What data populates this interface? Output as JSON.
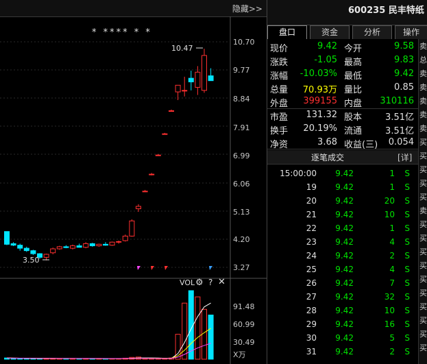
{
  "chart_header": {
    "hide_label": "隐藏>>"
  },
  "stock": {
    "code": "600235",
    "name": "民丰特纸"
  },
  "tabs": [
    "盘口",
    "资金",
    "分析",
    "操作"
  ],
  "quote_rows": [
    {
      "l1": "现价",
      "v1": "9.42",
      "c1": "green",
      "l2": "今开",
      "v2": "9.58",
      "c2": "green"
    },
    {
      "l1": "涨跌",
      "v1": "-1.05",
      "c1": "green",
      "l2": "最高",
      "v2": "9.83",
      "c2": "green"
    },
    {
      "l1": "涨幅",
      "v1": "-10.03%",
      "c1": "green",
      "l2": "最低",
      "v2": "9.42",
      "c2": "green"
    },
    {
      "l1": "总量",
      "v1": "70.93万",
      "c1": "yellow",
      "l2": "量比",
      "v2": "0.85",
      "c2": "white"
    },
    {
      "l1": "外盘",
      "v1": "399155",
      "c1": "red",
      "l2": "内盘",
      "v2": "310116",
      "c2": "green"
    },
    {
      "l1": "市盈",
      "v1": "131.32",
      "c1": "white",
      "l2": "股本",
      "v2": "3.51亿",
      "c2": "white"
    },
    {
      "l1": "换手",
      "v1": "20.19%",
      "c1": "white",
      "l2": "流通",
      "v2": "3.51亿",
      "c2": "white"
    },
    {
      "l1": "净资",
      "v1": "3.68",
      "c1": "white",
      "l2": "收益(三)",
      "v2": "0.054",
      "c2": "white"
    }
  ],
  "ticks_header": {
    "title": "逐笔成交",
    "detail": "[详]"
  },
  "ticks": [
    {
      "time": "15:00:00",
      "price": "9.42",
      "vol": "1",
      "side": "S"
    },
    {
      "time": "19",
      "price": "9.42",
      "vol": "1",
      "side": "S"
    },
    {
      "time": "20",
      "price": "9.42",
      "vol": "20",
      "side": "S"
    },
    {
      "time": "21",
      "price": "9.42",
      "vol": "10",
      "side": "S"
    },
    {
      "time": "22",
      "price": "9.42",
      "vol": "1",
      "side": "S"
    },
    {
      "time": "23",
      "price": "9.42",
      "vol": "4",
      "side": "S"
    },
    {
      "time": "24",
      "price": "9.42",
      "vol": "2",
      "side": "S"
    },
    {
      "time": "25",
      "price": "9.42",
      "vol": "4",
      "side": "S"
    },
    {
      "time": "26",
      "price": "9.42",
      "vol": "7",
      "side": "S"
    },
    {
      "time": "27",
      "price": "9.42",
      "vol": "32",
      "side": "S"
    },
    {
      "time": "28",
      "price": "9.42",
      "vol": "10",
      "side": "S"
    },
    {
      "time": "29",
      "price": "9.42",
      "vol": "16",
      "side": "S"
    },
    {
      "time": "30",
      "price": "9.42",
      "vol": "5",
      "side": "S"
    },
    {
      "time": "31",
      "price": "9.42",
      "vol": "2",
      "side": "S"
    }
  ],
  "side_labels": [
    "卖",
    "总",
    "卖",
    "卖",
    "卖",
    "卖",
    "卖",
    "买",
    "买",
    "买",
    "买",
    "买",
    "卖",
    "买",
    "买",
    "买",
    "买",
    "买",
    "买",
    "买",
    "买",
    "买",
    "买"
  ],
  "price_axis": [
    "10.70",
    "9.77",
    "8.84",
    "7.91",
    "6.99",
    "6.06",
    "5.13",
    "4.20",
    "3.27"
  ],
  "annotations": {
    "high": "10.47",
    "low": "3.50",
    "stars": "* **** * *"
  },
  "vol_panel": {
    "title": "VOL",
    "axis": [
      "91.48",
      "60.99",
      "30.49"
    ],
    "unit": "X万"
  },
  "colors": {
    "up": "#ff3030",
    "down": "#00e4ff",
    "ma1": "#ffffff",
    "ma2": "#ffff00",
    "ma3": "#ff44ff"
  },
  "chart_data": {
    "type": "candlestick",
    "ylim": [
      3.27,
      10.7
    ],
    "candles": [
      {
        "o": 4.45,
        "h": 4.45,
        "l": 4.0,
        "c": 4.03
      },
      {
        "o": 4.05,
        "h": 4.1,
        "l": 3.97,
        "c": 4.0
      },
      {
        "o": 4.0,
        "h": 4.05,
        "l": 3.82,
        "c": 3.9
      },
      {
        "o": 3.9,
        "h": 3.95,
        "l": 3.78,
        "c": 3.82
      },
      {
        "o": 3.82,
        "h": 3.85,
        "l": 3.68,
        "c": 3.72
      },
      {
        "o": 3.72,
        "h": 3.74,
        "l": 3.55,
        "c": 3.6
      },
      {
        "o": 3.6,
        "h": 3.72,
        "l": 3.5,
        "c": 3.7
      },
      {
        "o": 3.75,
        "h": 3.92,
        "l": 3.7,
        "c": 3.88
      },
      {
        "o": 3.88,
        "h": 3.98,
        "l": 3.85,
        "c": 3.95
      },
      {
        "o": 3.95,
        "h": 4.0,
        "l": 3.9,
        "c": 3.92
      },
      {
        "o": 3.9,
        "h": 4.02,
        "l": 3.86,
        "c": 3.98
      },
      {
        "o": 3.98,
        "h": 4.05,
        "l": 3.92,
        "c": 3.93
      },
      {
        "o": 3.93,
        "h": 4.1,
        "l": 3.9,
        "c": 4.05
      },
      {
        "o": 4.05,
        "h": 4.08,
        "l": 3.95,
        "c": 3.98
      },
      {
        "o": 3.98,
        "h": 4.05,
        "l": 3.95,
        "c": 4.03
      },
      {
        "o": 4.03,
        "h": 4.1,
        "l": 3.98,
        "c": 4.0
      },
      {
        "o": 4.0,
        "h": 4.12,
        "l": 3.98,
        "c": 4.1
      },
      {
        "o": 4.1,
        "h": 4.15,
        "l": 4.05,
        "c": 4.12
      },
      {
        "o": 4.15,
        "h": 4.35,
        "l": 4.12,
        "c": 4.3
      },
      {
        "o": 4.3,
        "h": 4.85,
        "l": 4.28,
        "c": 4.8
      },
      {
        "o": 5.2,
        "h": 5.35,
        "l": 5.1,
        "c": 5.28
      },
      {
        "o": 5.78,
        "h": 5.82,
        "l": 5.75,
        "c": 5.78
      },
      {
        "o": 6.34,
        "h": 6.38,
        "l": 6.3,
        "c": 6.34
      },
      {
        "o": 6.97,
        "h": 7.0,
        "l": 6.94,
        "c": 6.97
      },
      {
        "o": 7.67,
        "h": 7.7,
        "l": 7.64,
        "c": 7.67
      },
      {
        "o": 8.43,
        "h": 8.47,
        "l": 8.4,
        "c": 8.43
      },
      {
        "o": 9.05,
        "h": 9.27,
        "l": 8.78,
        "c": 9.27
      },
      {
        "o": 9.1,
        "h": 9.55,
        "l": 8.9,
        "c": 9.1
      },
      {
        "o": 9.5,
        "h": 9.75,
        "l": 9.1,
        "c": 9.38
      },
      {
        "o": 9.2,
        "h": 9.9,
        "l": 8.95,
        "c": 9.7
      },
      {
        "o": 9.1,
        "h": 10.47,
        "l": 9.02,
        "c": 10.25
      },
      {
        "o": 9.58,
        "h": 9.83,
        "l": 9.42,
        "c": 9.42
      }
    ],
    "volumes": [
      2,
      1.6,
      1.5,
      1.2,
      1.1,
      1.0,
      1.1,
      1.2,
      1.0,
      1.1,
      1.0,
      0.9,
      1.1,
      1.0,
      0.9,
      1.0,
      1.1,
      1.0,
      1.6,
      3,
      3.5,
      1,
      1,
      1,
      1,
      2,
      40,
      90,
      110,
      100,
      80,
      70.93
    ]
  }
}
